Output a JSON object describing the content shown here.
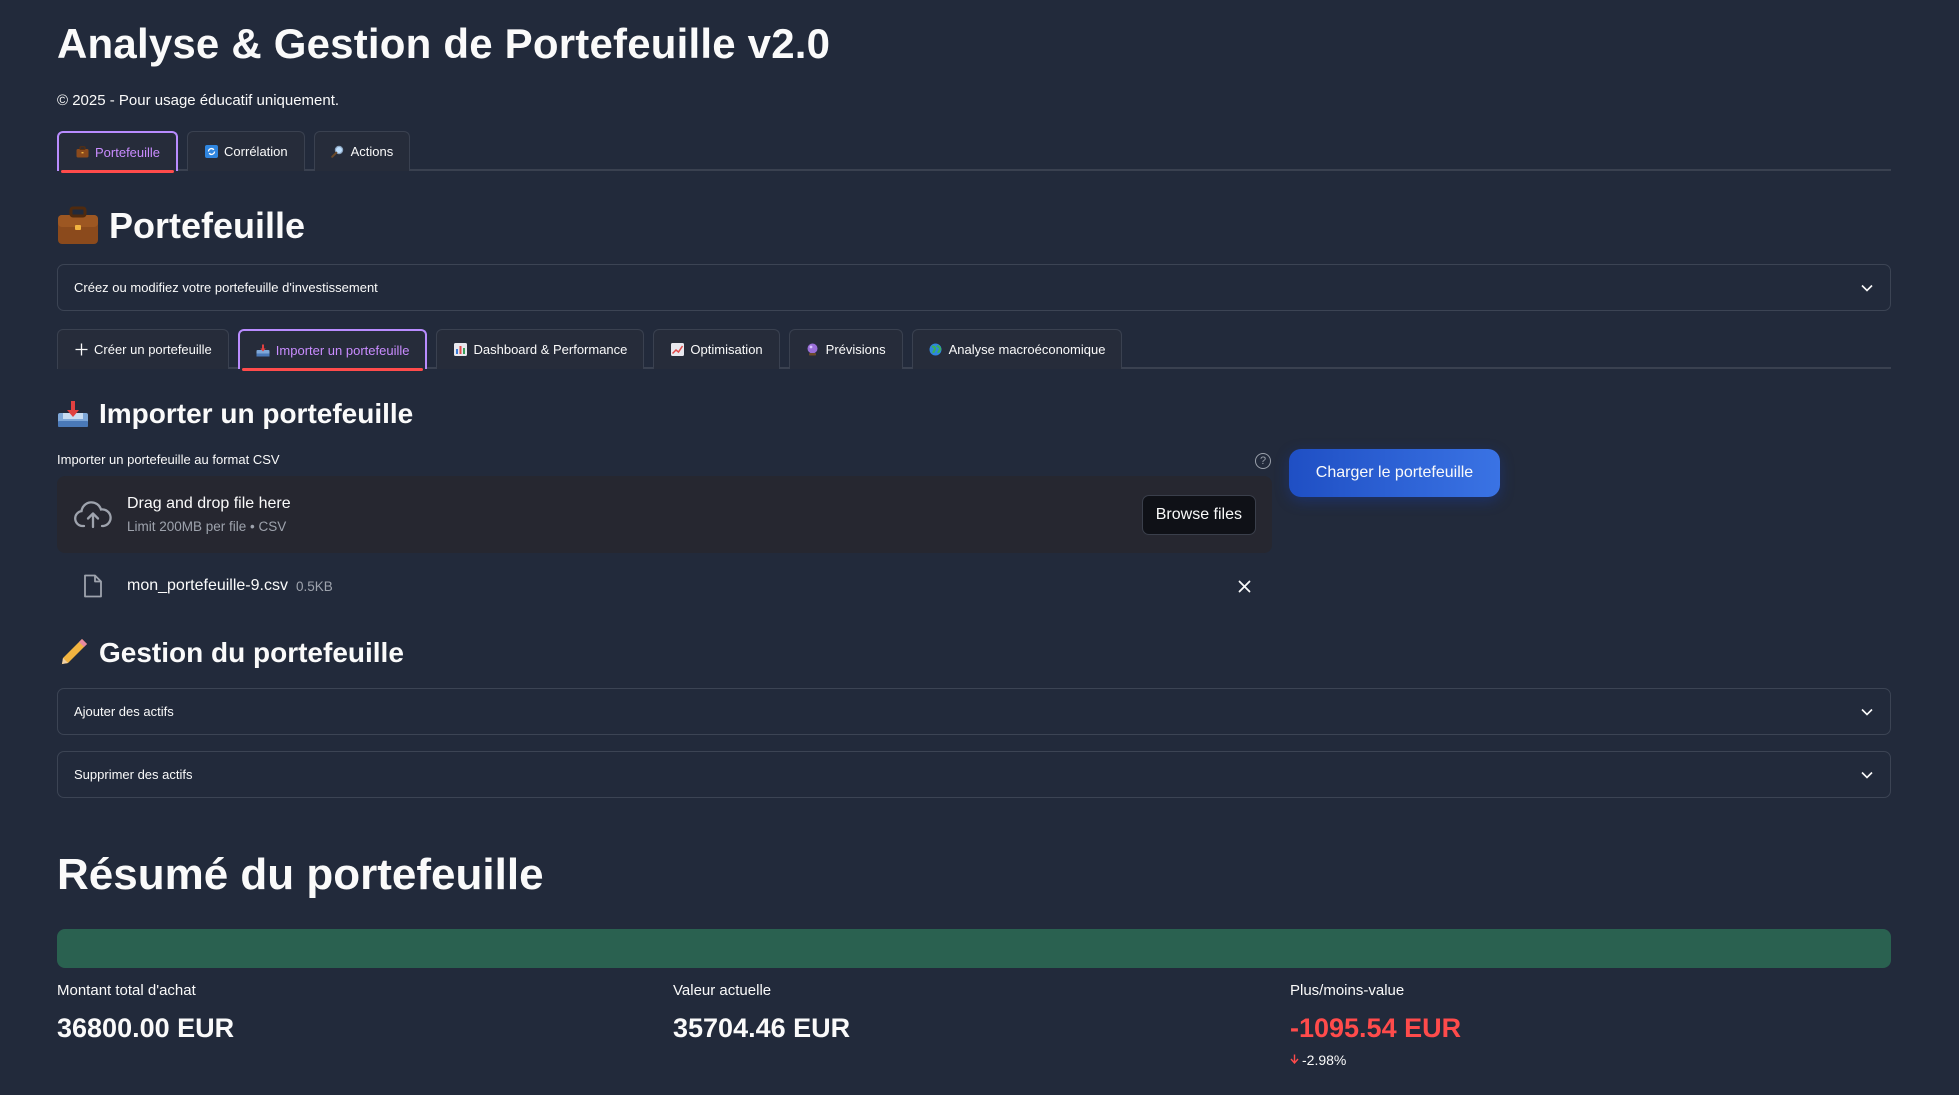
{
  "app": {
    "title": "Analyse & Gestion de Portefeuille v2.0",
    "caption": "© 2025 - Pour usage éducatif uniquement."
  },
  "main_tabs": [
    {
      "label": "Portefeuille",
      "icon": "briefcase-icon",
      "active": true
    },
    {
      "label": "Corrélation",
      "icon": "refresh-icon",
      "active": false
    },
    {
      "label": "Actions",
      "icon": "magnifier-icon",
      "active": false
    }
  ],
  "portfolio": {
    "title": "Portefeuille",
    "icon": "briefcase-icon",
    "expander_label": "Créez ou modifiez votre portefeuille d'investissement"
  },
  "sub_tabs": [
    {
      "label": "Créer un portefeuille",
      "icon": "plus-icon",
      "active": false
    },
    {
      "label": "Importer un portefeuille",
      "icon": "inbox-tray-icon",
      "active": true
    },
    {
      "label": "Dashboard & Performance",
      "icon": "bar-chart-icon",
      "active": false
    },
    {
      "label": "Optimisation",
      "icon": "line-chart-icon",
      "active": false
    },
    {
      "label": "Prévisions",
      "icon": "crystal-ball-icon",
      "active": false
    },
    {
      "label": "Analyse macroéconomique",
      "icon": "globe-icon",
      "active": false
    }
  ],
  "import": {
    "title": "Importer un portefeuille",
    "icon": "inbox-tray-icon",
    "uploader_label": "Importer un portefeuille au format CSV",
    "dropzone_title": "Drag and drop file here",
    "dropzone_limit": "Limit 200MB per file • CSV",
    "browse_label": "Browse files",
    "file_name": "mon_portefeuille-9.csv",
    "file_size": "0.5KB",
    "load_button": "Charger le portefeuille"
  },
  "gestion": {
    "title": "Gestion du portefeuille",
    "icon": "pencil-icon",
    "add_label": "Ajouter des actifs",
    "remove_label": "Supprimer des actifs"
  },
  "summary": {
    "title": "Résumé du portefeuille",
    "progress": 1.0,
    "progress_color": "#2a6150",
    "metrics": [
      {
        "label": "Montant total d'achat",
        "value": "36800.00 EUR"
      },
      {
        "label": "Valeur actuelle",
        "value": "35704.46 EUR"
      },
      {
        "label": "Plus/moins-value",
        "value": "-1095.54 EUR",
        "delta": "-2.98%"
      }
    ]
  },
  "colors": {
    "background": "#222a3b",
    "accent_tab": "#c98cff",
    "tab_underline": "#ff4b4b",
    "primary_button": "#2b5fd6",
    "negative": "#ff4b4b"
  }
}
